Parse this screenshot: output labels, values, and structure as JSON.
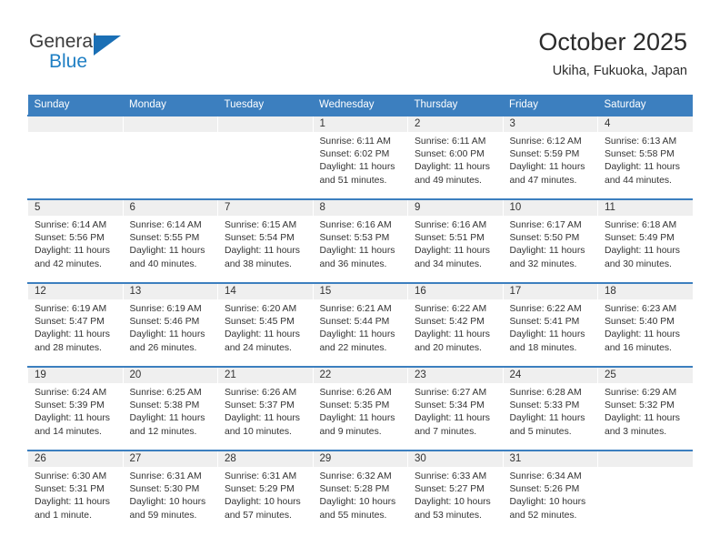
{
  "brand": {
    "name_part1": "General",
    "name_part2": "Blue"
  },
  "header": {
    "title": "October 2025",
    "subtitle": "Ukiha, Fukuoka, Japan"
  },
  "weekdays": [
    "Sunday",
    "Monday",
    "Tuesday",
    "Wednesday",
    "Thursday",
    "Friday",
    "Saturday"
  ],
  "colors": {
    "header_blue": "#3c7fbf",
    "daynum_band": "#efefef",
    "brand_blue": "#1f7fc4",
    "text": "#333333"
  },
  "weeks": [
    [
      {
        "day": "",
        "empty": true
      },
      {
        "day": "",
        "empty": true
      },
      {
        "day": "",
        "empty": true
      },
      {
        "day": "1",
        "sunrise": "Sunrise: 6:11 AM",
        "sunset": "Sunset: 6:02 PM",
        "daylight": "Daylight: 11 hours and 51 minutes."
      },
      {
        "day": "2",
        "sunrise": "Sunrise: 6:11 AM",
        "sunset": "Sunset: 6:00 PM",
        "daylight": "Daylight: 11 hours and 49 minutes."
      },
      {
        "day": "3",
        "sunrise": "Sunrise: 6:12 AM",
        "sunset": "Sunset: 5:59 PM",
        "daylight": "Daylight: 11 hours and 47 minutes."
      },
      {
        "day": "4",
        "sunrise": "Sunrise: 6:13 AM",
        "sunset": "Sunset: 5:58 PM",
        "daylight": "Daylight: 11 hours and 44 minutes."
      }
    ],
    [
      {
        "day": "5",
        "sunrise": "Sunrise: 6:14 AM",
        "sunset": "Sunset: 5:56 PM",
        "daylight": "Daylight: 11 hours and 42 minutes."
      },
      {
        "day": "6",
        "sunrise": "Sunrise: 6:14 AM",
        "sunset": "Sunset: 5:55 PM",
        "daylight": "Daylight: 11 hours and 40 minutes."
      },
      {
        "day": "7",
        "sunrise": "Sunrise: 6:15 AM",
        "sunset": "Sunset: 5:54 PM",
        "daylight": "Daylight: 11 hours and 38 minutes."
      },
      {
        "day": "8",
        "sunrise": "Sunrise: 6:16 AM",
        "sunset": "Sunset: 5:53 PM",
        "daylight": "Daylight: 11 hours and 36 minutes."
      },
      {
        "day": "9",
        "sunrise": "Sunrise: 6:16 AM",
        "sunset": "Sunset: 5:51 PM",
        "daylight": "Daylight: 11 hours and 34 minutes."
      },
      {
        "day": "10",
        "sunrise": "Sunrise: 6:17 AM",
        "sunset": "Sunset: 5:50 PM",
        "daylight": "Daylight: 11 hours and 32 minutes."
      },
      {
        "day": "11",
        "sunrise": "Sunrise: 6:18 AM",
        "sunset": "Sunset: 5:49 PM",
        "daylight": "Daylight: 11 hours and 30 minutes."
      }
    ],
    [
      {
        "day": "12",
        "sunrise": "Sunrise: 6:19 AM",
        "sunset": "Sunset: 5:47 PM",
        "daylight": "Daylight: 11 hours and 28 minutes."
      },
      {
        "day": "13",
        "sunrise": "Sunrise: 6:19 AM",
        "sunset": "Sunset: 5:46 PM",
        "daylight": "Daylight: 11 hours and 26 minutes."
      },
      {
        "day": "14",
        "sunrise": "Sunrise: 6:20 AM",
        "sunset": "Sunset: 5:45 PM",
        "daylight": "Daylight: 11 hours and 24 minutes."
      },
      {
        "day": "15",
        "sunrise": "Sunrise: 6:21 AM",
        "sunset": "Sunset: 5:44 PM",
        "daylight": "Daylight: 11 hours and 22 minutes."
      },
      {
        "day": "16",
        "sunrise": "Sunrise: 6:22 AM",
        "sunset": "Sunset: 5:42 PM",
        "daylight": "Daylight: 11 hours and 20 minutes."
      },
      {
        "day": "17",
        "sunrise": "Sunrise: 6:22 AM",
        "sunset": "Sunset: 5:41 PM",
        "daylight": "Daylight: 11 hours and 18 minutes."
      },
      {
        "day": "18",
        "sunrise": "Sunrise: 6:23 AM",
        "sunset": "Sunset: 5:40 PM",
        "daylight": "Daylight: 11 hours and 16 minutes."
      }
    ],
    [
      {
        "day": "19",
        "sunrise": "Sunrise: 6:24 AM",
        "sunset": "Sunset: 5:39 PM",
        "daylight": "Daylight: 11 hours and 14 minutes."
      },
      {
        "day": "20",
        "sunrise": "Sunrise: 6:25 AM",
        "sunset": "Sunset: 5:38 PM",
        "daylight": "Daylight: 11 hours and 12 minutes."
      },
      {
        "day": "21",
        "sunrise": "Sunrise: 6:26 AM",
        "sunset": "Sunset: 5:37 PM",
        "daylight": "Daylight: 11 hours and 10 minutes."
      },
      {
        "day": "22",
        "sunrise": "Sunrise: 6:26 AM",
        "sunset": "Sunset: 5:35 PM",
        "daylight": "Daylight: 11 hours and 9 minutes."
      },
      {
        "day": "23",
        "sunrise": "Sunrise: 6:27 AM",
        "sunset": "Sunset: 5:34 PM",
        "daylight": "Daylight: 11 hours and 7 minutes."
      },
      {
        "day": "24",
        "sunrise": "Sunrise: 6:28 AM",
        "sunset": "Sunset: 5:33 PM",
        "daylight": "Daylight: 11 hours and 5 minutes."
      },
      {
        "day": "25",
        "sunrise": "Sunrise: 6:29 AM",
        "sunset": "Sunset: 5:32 PM",
        "daylight": "Daylight: 11 hours and 3 minutes."
      }
    ],
    [
      {
        "day": "26",
        "sunrise": "Sunrise: 6:30 AM",
        "sunset": "Sunset: 5:31 PM",
        "daylight": "Daylight: 11 hours and 1 minute."
      },
      {
        "day": "27",
        "sunrise": "Sunrise: 6:31 AM",
        "sunset": "Sunset: 5:30 PM",
        "daylight": "Daylight: 10 hours and 59 minutes."
      },
      {
        "day": "28",
        "sunrise": "Sunrise: 6:31 AM",
        "sunset": "Sunset: 5:29 PM",
        "daylight": "Daylight: 10 hours and 57 minutes."
      },
      {
        "day": "29",
        "sunrise": "Sunrise: 6:32 AM",
        "sunset": "Sunset: 5:28 PM",
        "daylight": "Daylight: 10 hours and 55 minutes."
      },
      {
        "day": "30",
        "sunrise": "Sunrise: 6:33 AM",
        "sunset": "Sunset: 5:27 PM",
        "daylight": "Daylight: 10 hours and 53 minutes."
      },
      {
        "day": "31",
        "sunrise": "Sunrise: 6:34 AM",
        "sunset": "Sunset: 5:26 PM",
        "daylight": "Daylight: 10 hours and 52 minutes."
      },
      {
        "day": "",
        "empty": true
      }
    ]
  ]
}
